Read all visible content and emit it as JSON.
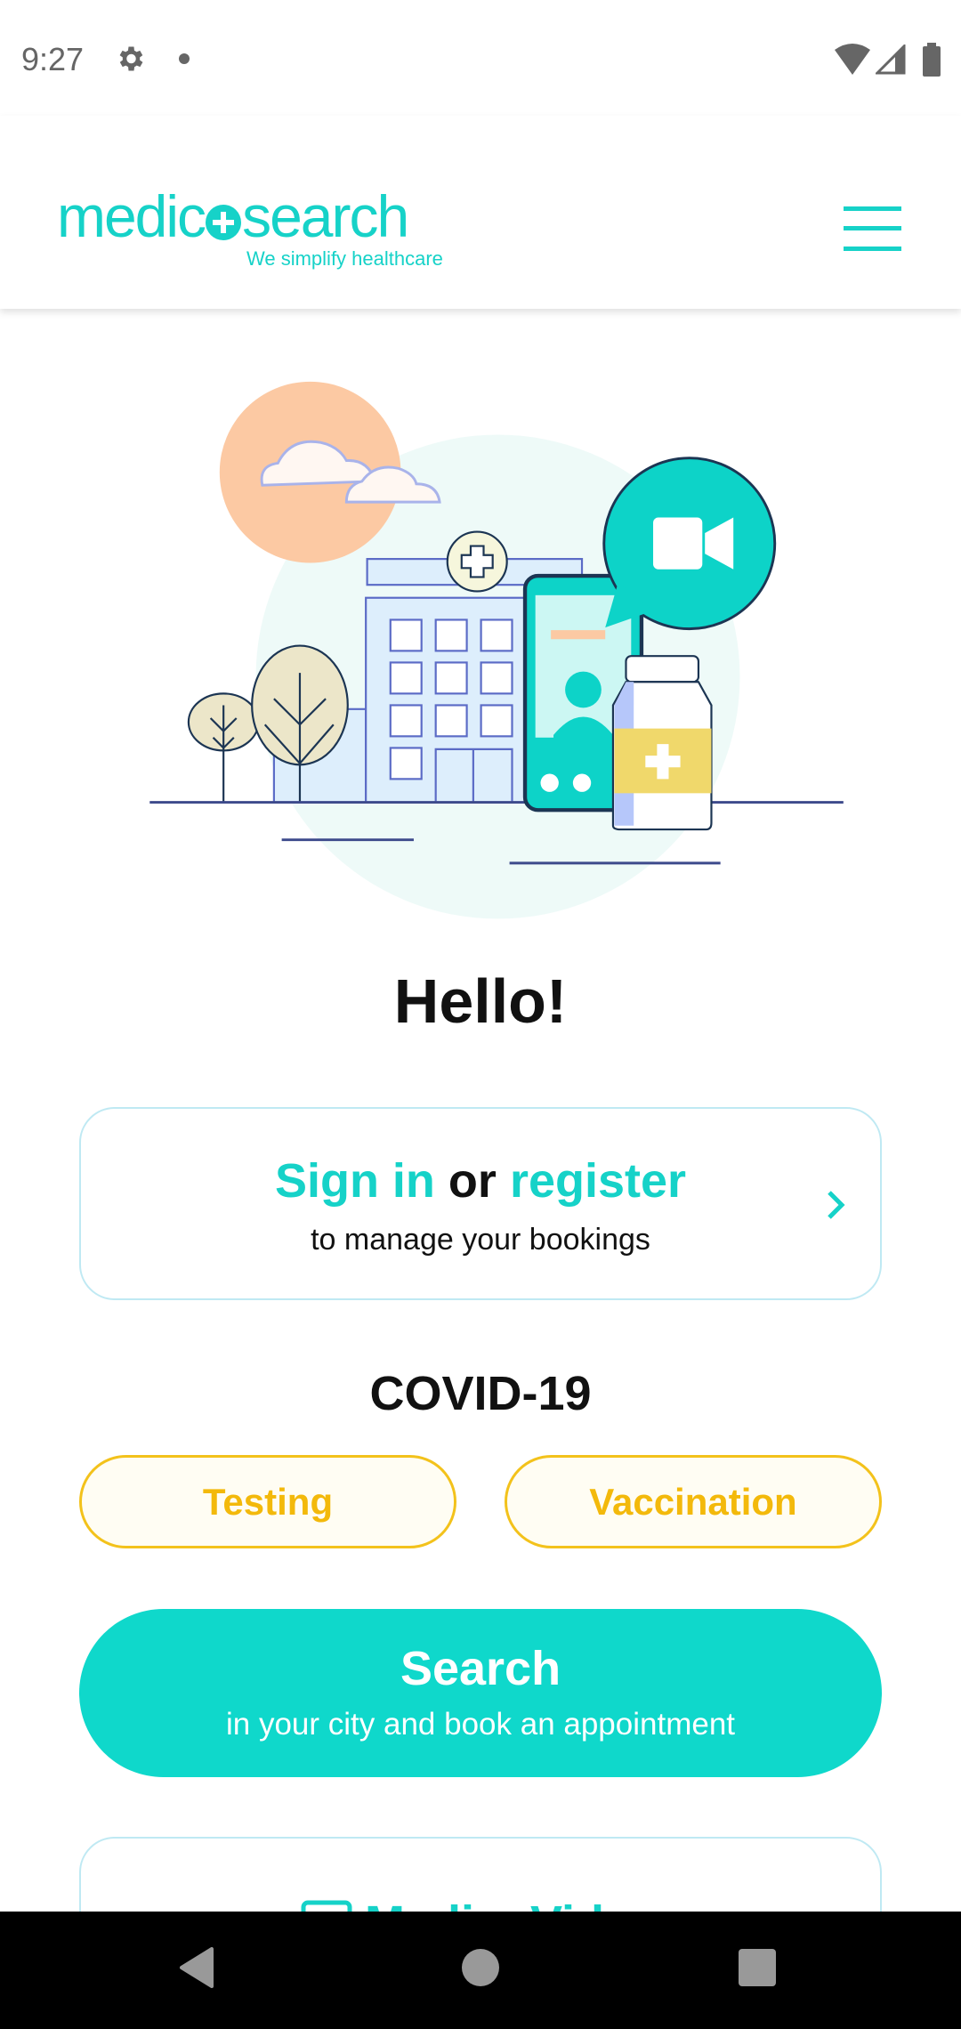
{
  "status_bar": {
    "time": "9:27",
    "icons": [
      "gear-icon",
      "notification-dot-icon",
      "wifi-icon",
      "signal-icon",
      "battery-icon"
    ]
  },
  "header": {
    "logo": "medico+search",
    "logo_left": "medic",
    "logo_right": "search",
    "tagline": "We simplify healthcare",
    "menu_icon": "hamburger-icon"
  },
  "greeting": "Hello!",
  "signin_card": {
    "sign_in": "Sign in",
    "or": " or ",
    "register": "register",
    "subtitle": "to manage your bookings"
  },
  "covid": {
    "title": "COVID-19",
    "testing": "Testing",
    "vaccination": "Vaccination"
  },
  "search": {
    "title": "Search",
    "subtitle": "in your city and book an appointment"
  },
  "video_card": {
    "title": "MedicoVideo"
  },
  "colors": {
    "brand": "#16d2c8",
    "covid": "#f3c21b",
    "border": "#bfe9f3"
  }
}
